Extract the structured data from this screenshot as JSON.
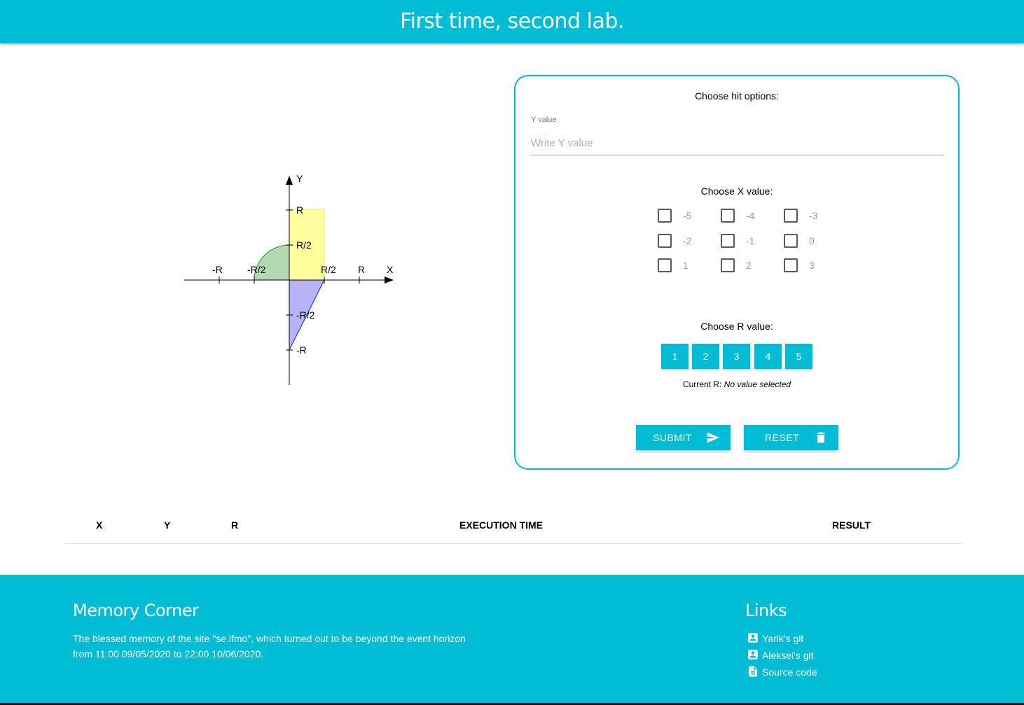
{
  "header": {
    "title": "First time, second lab."
  },
  "graph": {
    "axis_x_label": "X",
    "axis_y_label": "Y",
    "x_ticks": [
      "-R",
      "-R/2",
      "R/2",
      "R"
    ],
    "y_ticks": [
      "R",
      "R/2",
      "-R/2",
      "-R"
    ],
    "colors": {
      "rectangle": "#ffff9e",
      "quarter_circle": "#b3d9b3",
      "triangle": "#b3b3f5"
    }
  },
  "form": {
    "title": "Choose hit options:",
    "y_field": {
      "label": "Y value",
      "placeholder": "Write Y value",
      "value": ""
    },
    "x_title": "Choose X value:",
    "x_options": [
      "-5",
      "-4",
      "-3",
      "-2",
      "-1",
      "0",
      "1",
      "2",
      "3"
    ],
    "r_title": "Choose R value:",
    "r_options": [
      "1",
      "2",
      "3",
      "4",
      "5"
    ],
    "current_r_label": "Current R:",
    "current_r_value": "No value selected",
    "submit_label": "SUBMIT",
    "reset_label": "RESET"
  },
  "table": {
    "headers": {
      "x": "X",
      "y": "Y",
      "r": "R",
      "time": "EXECUTION TIME",
      "result": "RESULT"
    },
    "rows": []
  },
  "footer": {
    "memory_title": "Memory Corner",
    "memory_text_line1": "The blessed memory of the site \"se.ifmo\", which turned out to be beyond the event horizon",
    "memory_text_line2": "from 11:00 09/05/2020 to 22:00 10/06/2020.",
    "links_title": "Links",
    "links": [
      {
        "label": "Yarik's git",
        "icon": "account-box-icon"
      },
      {
        "label": "Aleksei's git",
        "icon": "account-box-icon"
      },
      {
        "label": "Source code",
        "icon": "description-icon"
      }
    ]
  },
  "colors": {
    "accent": "#00bcd4"
  }
}
